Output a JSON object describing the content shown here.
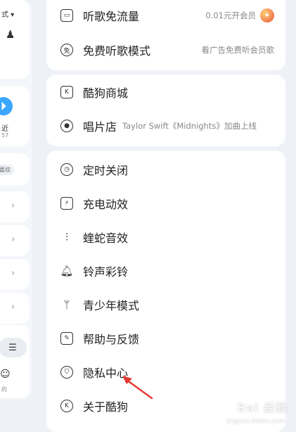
{
  "left_panel": {
    "top_label": "式 ▾",
    "recent_label": "近",
    "recent_count": "57",
    "like_tag": "喜欢",
    "bottom_label": "的"
  },
  "menu": {
    "group1": [
      {
        "label": "听歌免流量",
        "sub": "0.01元开会员",
        "icon": "sim-card-icon"
      },
      {
        "label": "免费听歌模式",
        "sub": "看广告免费听会员歌",
        "icon": "free-mode-icon"
      }
    ],
    "group2": [
      {
        "label": "酷狗商城",
        "sub": "",
        "icon": "store-icon"
      },
      {
        "label": "唱片店",
        "sub": "Taylor Swift《Midnights》加曲上线",
        "icon": "record-store-icon"
      }
    ],
    "group3": [
      {
        "label": "定时关闭",
        "icon": "timer-icon"
      },
      {
        "label": "充电动效",
        "icon": "charging-icon"
      },
      {
        "label": "蝰蛇音效",
        "icon": "equalizer-icon"
      },
      {
        "label": "铃声彩铃",
        "icon": "bell-icon"
      },
      {
        "label": "青少年模式",
        "icon": "sprout-icon"
      },
      {
        "label": "帮助与反馈",
        "icon": "feedback-icon"
      },
      {
        "label": "隐私中心",
        "icon": "privacy-icon"
      },
      {
        "label": "关于酷狗",
        "icon": "about-icon"
      }
    ]
  },
  "watermark": {
    "text": "Bai 经验",
    "url": "jingyan.baidu.com"
  },
  "colors": {
    "background": "#eef2f7",
    "card": "#ffffff",
    "annotation_arrow": "#e53935"
  }
}
